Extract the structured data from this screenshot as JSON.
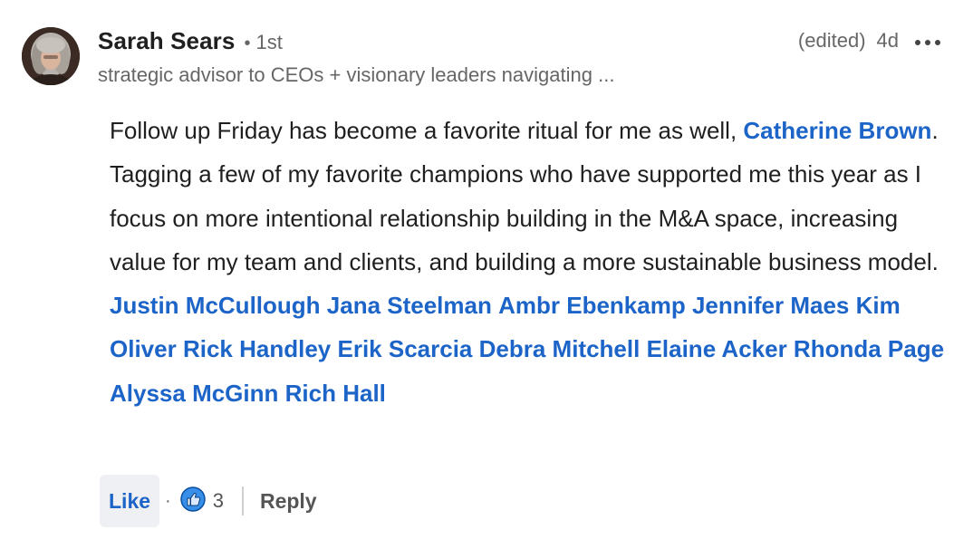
{
  "comment": {
    "author": {
      "name": "Sarah Sears",
      "separator": "•",
      "degree": "1st",
      "headline": "strategic advisor to CEOs + visionary leaders navigating ..."
    },
    "meta": {
      "edited": "(edited)",
      "time": "4d",
      "more_icon": "ellipsis-horizontal-icon"
    },
    "body": [
      {
        "type": "text",
        "text": "Follow up Friday has become a favorite ritual for me as well, "
      },
      {
        "type": "mention",
        "text": "Catherine Brown"
      },
      {
        "type": "text",
        "text": ". Tagging a few of my favorite champions who have supported me this year as I focus on more intentional relationship building in the M&A space, increasing value for my team and clients, and building a more sustainable business model. "
      },
      {
        "type": "mention",
        "text": "Justin McCullough"
      },
      {
        "type": "text",
        "text": " "
      },
      {
        "type": "mention",
        "text": "Jana Steelman"
      },
      {
        "type": "text",
        "text": " "
      },
      {
        "type": "mention",
        "text": "Ambr Ebenkamp"
      },
      {
        "type": "text",
        "text": " "
      },
      {
        "type": "mention",
        "text": "Jennifer Maes"
      },
      {
        "type": "text",
        "text": " "
      },
      {
        "type": "mention",
        "text": "Kim Oliver"
      },
      {
        "type": "text",
        "text": " "
      },
      {
        "type": "mention",
        "text": "Rick Handley"
      },
      {
        "type": "text",
        "text": " "
      },
      {
        "type": "mention",
        "text": "Erik Scarcia"
      },
      {
        "type": "text",
        "text": " "
      },
      {
        "type": "mention",
        "text": "Debra Mitchell"
      },
      {
        "type": "text",
        "text": " "
      },
      {
        "type": "mention",
        "text": "Elaine Acker"
      },
      {
        "type": "text",
        "text": " "
      },
      {
        "type": "mention",
        "text": "Rhonda Page"
      },
      {
        "type": "text",
        "text": " "
      },
      {
        "type": "mention",
        "text": "Alyssa McGinn"
      },
      {
        "type": "text",
        "text": " "
      },
      {
        "type": "mention",
        "text": "Rich Hall"
      }
    ],
    "actions": {
      "like_label": "Like",
      "separator": "·",
      "reaction_icon": "thumbs-up-icon",
      "reaction_count": "3",
      "reply_label": "Reply"
    }
  },
  "colors": {
    "mention": "#1c64c8",
    "text": "#1f1f1f",
    "muted": "#666666",
    "like_bg": "#eef0f3",
    "reaction_blue": "#378fe9"
  }
}
